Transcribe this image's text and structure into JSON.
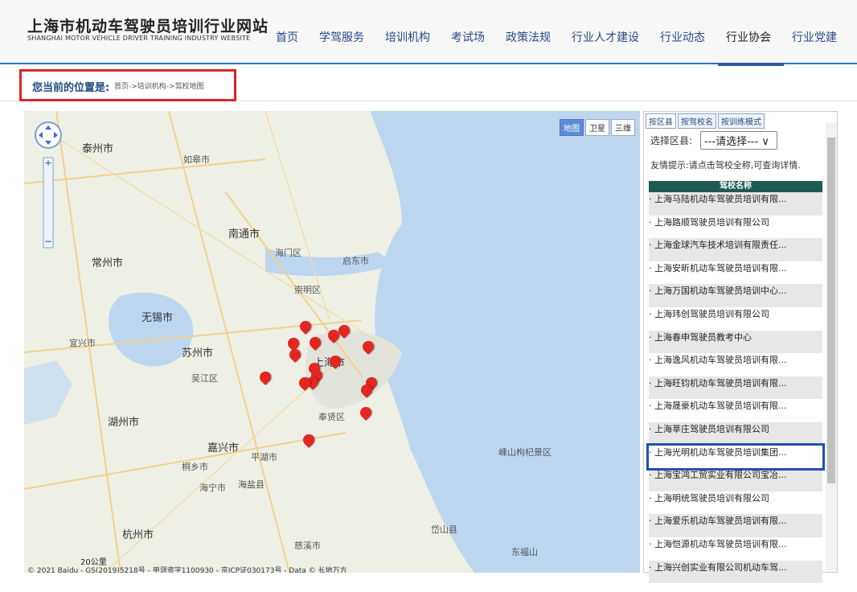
{
  "header": {
    "logo_cn": "上海市机动车驾驶员培训行业网站",
    "logo_en": "SHANGHAI MOTOR VEHICLE DRIVER TRAINING INDUSTRY WEBSITE",
    "nav": [
      "首页",
      "学驾服务",
      "培训机构",
      "考试场",
      "政策法规",
      "行业人才建设",
      "行业动态",
      "行业协会",
      "行业党建"
    ],
    "active_nav": "行业协会"
  },
  "breadcrumb": {
    "title": "您当前的位置是:",
    "path": "首页->培训机构->驾校地图"
  },
  "map": {
    "types": [
      "地图",
      "卫星",
      "三维"
    ],
    "active_type": "地图",
    "labels": [
      {
        "text": "泰州市",
        "cls": "city"
      },
      {
        "text": "如皋市",
        "cls": ""
      },
      {
        "text": "南通市",
        "cls": "city"
      },
      {
        "text": "常州市",
        "cls": "city"
      },
      {
        "text": "无锡市",
        "cls": "city"
      },
      {
        "text": "苏州市",
        "cls": "city"
      },
      {
        "text": "上海市",
        "cls": "city"
      },
      {
        "text": "湖州市",
        "cls": "city"
      },
      {
        "text": "嘉兴市",
        "cls": "city"
      },
      {
        "text": "杭州市",
        "cls": "city"
      },
      {
        "text": "平湖市",
        "cls": ""
      },
      {
        "text": "海盐县",
        "cls": ""
      },
      {
        "text": "嵊山枸杞景区",
        "cls": ""
      },
      {
        "text": "岱山县",
        "cls": ""
      },
      {
        "text": "崇明区",
        "cls": ""
      },
      {
        "text": "海门区",
        "cls": ""
      },
      {
        "text": "启东市",
        "cls": ""
      },
      {
        "text": "奉贤区",
        "cls": ""
      },
      {
        "text": "吴江区",
        "cls": ""
      },
      {
        "text": "桐乡市",
        "cls": ""
      },
      {
        "text": "海宁市",
        "cls": ""
      },
      {
        "text": "东福山",
        "cls": ""
      },
      {
        "text": "慈溪市",
        "cls": ""
      },
      {
        "text": "宜兴市",
        "cls": ""
      }
    ],
    "scale": "20公里",
    "copyright": "© 2021 Baidu - GS(2019)5218号 - 甲测资字1100930 - 京ICP证030173号 - Data © 长地万方"
  },
  "panel": {
    "tabs": [
      "按区县",
      "按驾校名",
      "按训练模式"
    ],
    "active_tab": "按区县",
    "select_label": "选择区县:",
    "select_value": "---请选择--- ∨",
    "tip": "友情提示:请点击驾校全称,可查询详情.",
    "list_header": "驾校名称",
    "schools": [
      "上海马陆机动车驾驶员培训有限...",
      "上海路顺驾驶员培训有限公司",
      "上海金球汽车技术培训有限责任...",
      "上海安昕机动车驾驶员培训有限...",
      "上海万国机动车驾驶员培训中心...",
      "上海玮创驾驶员培训有限公司",
      "上海春申驾驶员教考中心",
      "上海逸风机动车驾驶员培训有限...",
      "上海旺钧机动车驾驶员培训有限...",
      "上海晟豪机动车驾驶员培训有限...",
      "上海莘庄驾驶员培训有限公司",
      "上海光明机动车驾驶员培训集团...",
      "上海宝鸿工贸实业有限公司宝冶...",
      "上海明统驾驶员培训有限公司",
      "上海爱乐机动车驾驶员培训有限...",
      "上海恺源机动车驾驶员培训有限...",
      "上海兴创实业有限公司机动车驾..."
    ],
    "selected_index": 11
  }
}
